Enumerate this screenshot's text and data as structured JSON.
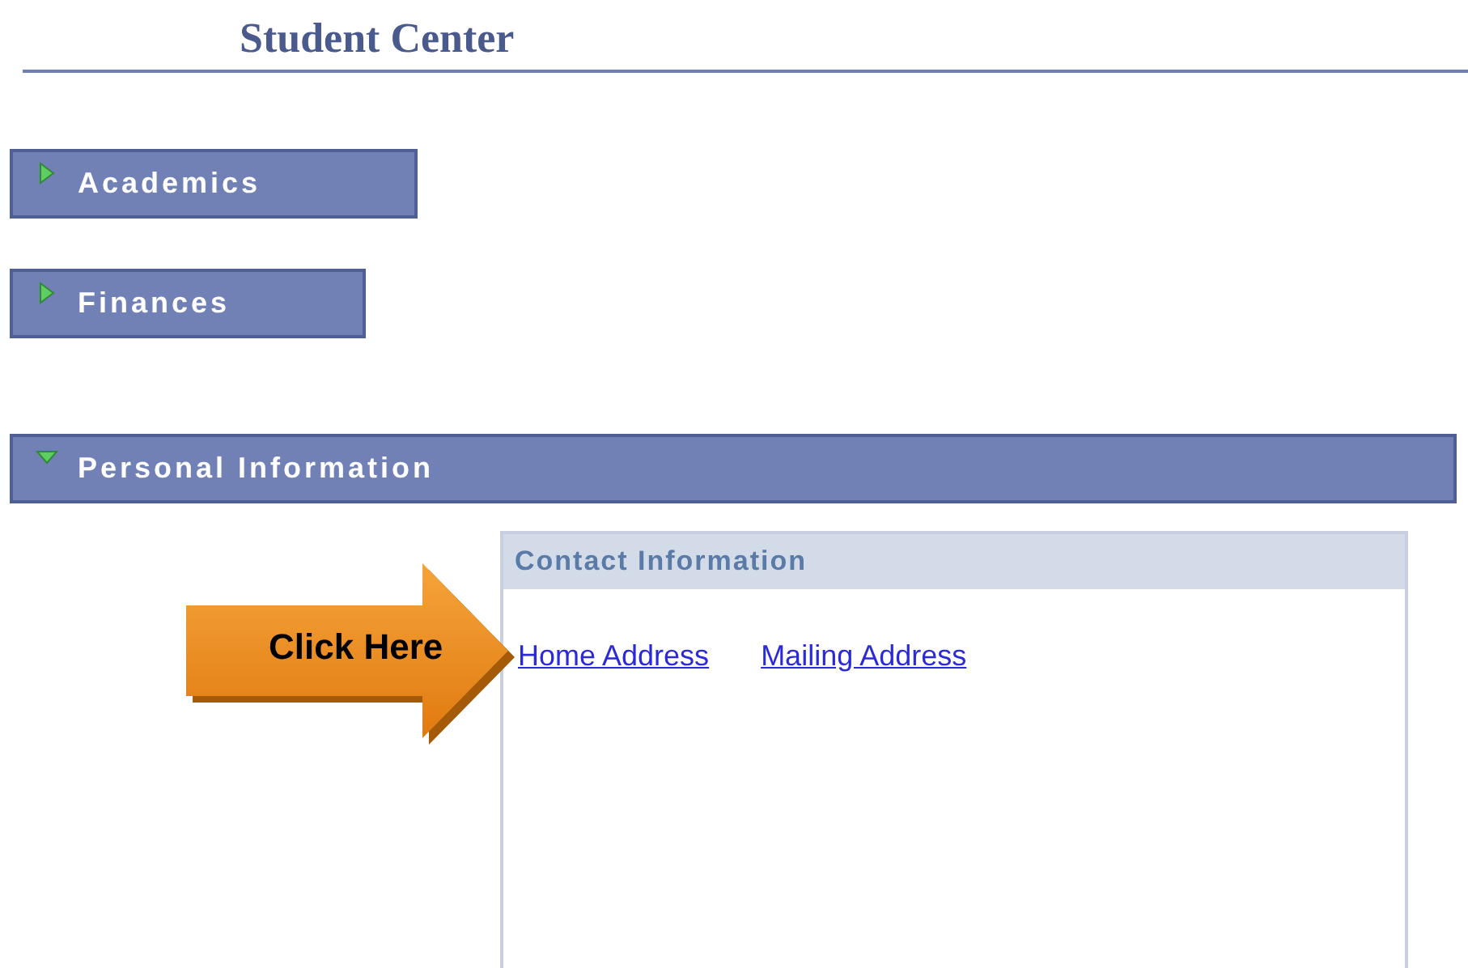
{
  "page": {
    "title": "Student Center"
  },
  "sections": [
    {
      "label": "Academics",
      "expanded": false
    },
    {
      "label": "Finances",
      "expanded": false
    },
    {
      "label": "Personal Information",
      "expanded": true
    }
  ],
  "contact_panel": {
    "title": "Contact Information",
    "links": [
      "Home Address",
      "Mailing Address"
    ]
  },
  "callout": {
    "label": "Click Here"
  }
}
